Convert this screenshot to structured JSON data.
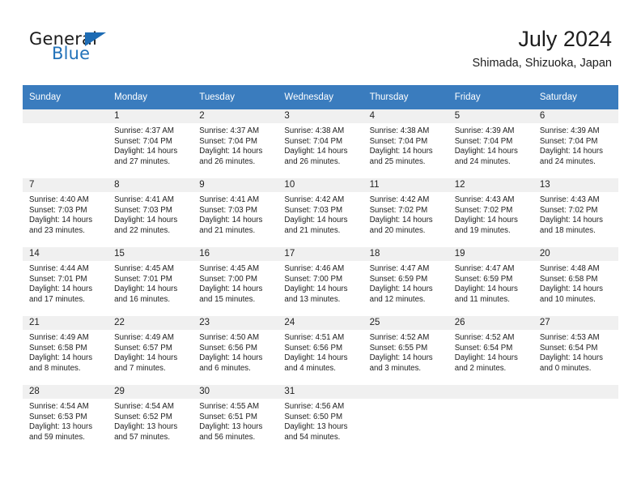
{
  "brand": {
    "name_part1": "General",
    "name_part2": "Blue",
    "logo_icon": "triangle-icon"
  },
  "header": {
    "title": "July 2024",
    "subtitle": "Shimada, Shizuoka, Japan"
  },
  "colors": {
    "header_blue": "#3a7cbe",
    "row_divider_blue": "#2f6fae",
    "daynum_band": "#f0f0f0",
    "brand_blue": "#2272b9"
  },
  "weekday_headers": [
    "Sunday",
    "Monday",
    "Tuesday",
    "Wednesday",
    "Thursday",
    "Friday",
    "Saturday"
  ],
  "weeks": [
    [
      {
        "day": "",
        "sunrise": "",
        "sunset": "",
        "daylight1": "",
        "daylight2": "",
        "empty": true
      },
      {
        "day": "1",
        "sunrise": "Sunrise: 4:37 AM",
        "sunset": "Sunset: 7:04 PM",
        "daylight1": "Daylight: 14 hours",
        "daylight2": "and 27 minutes.",
        "empty": false
      },
      {
        "day": "2",
        "sunrise": "Sunrise: 4:37 AM",
        "sunset": "Sunset: 7:04 PM",
        "daylight1": "Daylight: 14 hours",
        "daylight2": "and 26 minutes.",
        "empty": false
      },
      {
        "day": "3",
        "sunrise": "Sunrise: 4:38 AM",
        "sunset": "Sunset: 7:04 PM",
        "daylight1": "Daylight: 14 hours",
        "daylight2": "and 26 minutes.",
        "empty": false
      },
      {
        "day": "4",
        "sunrise": "Sunrise: 4:38 AM",
        "sunset": "Sunset: 7:04 PM",
        "daylight1": "Daylight: 14 hours",
        "daylight2": "and 25 minutes.",
        "empty": false
      },
      {
        "day": "5",
        "sunrise": "Sunrise: 4:39 AM",
        "sunset": "Sunset: 7:04 PM",
        "daylight1": "Daylight: 14 hours",
        "daylight2": "and 24 minutes.",
        "empty": false
      },
      {
        "day": "6",
        "sunrise": "Sunrise: 4:39 AM",
        "sunset": "Sunset: 7:04 PM",
        "daylight1": "Daylight: 14 hours",
        "daylight2": "and 24 minutes.",
        "empty": false
      }
    ],
    [
      {
        "day": "7",
        "sunrise": "Sunrise: 4:40 AM",
        "sunset": "Sunset: 7:03 PM",
        "daylight1": "Daylight: 14 hours",
        "daylight2": "and 23 minutes.",
        "empty": false
      },
      {
        "day": "8",
        "sunrise": "Sunrise: 4:41 AM",
        "sunset": "Sunset: 7:03 PM",
        "daylight1": "Daylight: 14 hours",
        "daylight2": "and 22 minutes.",
        "empty": false
      },
      {
        "day": "9",
        "sunrise": "Sunrise: 4:41 AM",
        "sunset": "Sunset: 7:03 PM",
        "daylight1": "Daylight: 14 hours",
        "daylight2": "and 21 minutes.",
        "empty": false
      },
      {
        "day": "10",
        "sunrise": "Sunrise: 4:42 AM",
        "sunset": "Sunset: 7:03 PM",
        "daylight1": "Daylight: 14 hours",
        "daylight2": "and 21 minutes.",
        "empty": false
      },
      {
        "day": "11",
        "sunrise": "Sunrise: 4:42 AM",
        "sunset": "Sunset: 7:02 PM",
        "daylight1": "Daylight: 14 hours",
        "daylight2": "and 20 minutes.",
        "empty": false
      },
      {
        "day": "12",
        "sunrise": "Sunrise: 4:43 AM",
        "sunset": "Sunset: 7:02 PM",
        "daylight1": "Daylight: 14 hours",
        "daylight2": "and 19 minutes.",
        "empty": false
      },
      {
        "day": "13",
        "sunrise": "Sunrise: 4:43 AM",
        "sunset": "Sunset: 7:02 PM",
        "daylight1": "Daylight: 14 hours",
        "daylight2": "and 18 minutes.",
        "empty": false
      }
    ],
    [
      {
        "day": "14",
        "sunrise": "Sunrise: 4:44 AM",
        "sunset": "Sunset: 7:01 PM",
        "daylight1": "Daylight: 14 hours",
        "daylight2": "and 17 minutes.",
        "empty": false
      },
      {
        "day": "15",
        "sunrise": "Sunrise: 4:45 AM",
        "sunset": "Sunset: 7:01 PM",
        "daylight1": "Daylight: 14 hours",
        "daylight2": "and 16 minutes.",
        "empty": false
      },
      {
        "day": "16",
        "sunrise": "Sunrise: 4:45 AM",
        "sunset": "Sunset: 7:00 PM",
        "daylight1": "Daylight: 14 hours",
        "daylight2": "and 15 minutes.",
        "empty": false
      },
      {
        "day": "17",
        "sunrise": "Sunrise: 4:46 AM",
        "sunset": "Sunset: 7:00 PM",
        "daylight1": "Daylight: 14 hours",
        "daylight2": "and 13 minutes.",
        "empty": false
      },
      {
        "day": "18",
        "sunrise": "Sunrise: 4:47 AM",
        "sunset": "Sunset: 6:59 PM",
        "daylight1": "Daylight: 14 hours",
        "daylight2": "and 12 minutes.",
        "empty": false
      },
      {
        "day": "19",
        "sunrise": "Sunrise: 4:47 AM",
        "sunset": "Sunset: 6:59 PM",
        "daylight1": "Daylight: 14 hours",
        "daylight2": "and 11 minutes.",
        "empty": false
      },
      {
        "day": "20",
        "sunrise": "Sunrise: 4:48 AM",
        "sunset": "Sunset: 6:58 PM",
        "daylight1": "Daylight: 14 hours",
        "daylight2": "and 10 minutes.",
        "empty": false
      }
    ],
    [
      {
        "day": "21",
        "sunrise": "Sunrise: 4:49 AM",
        "sunset": "Sunset: 6:58 PM",
        "daylight1": "Daylight: 14 hours",
        "daylight2": "and 8 minutes.",
        "empty": false
      },
      {
        "day": "22",
        "sunrise": "Sunrise: 4:49 AM",
        "sunset": "Sunset: 6:57 PM",
        "daylight1": "Daylight: 14 hours",
        "daylight2": "and 7 minutes.",
        "empty": false
      },
      {
        "day": "23",
        "sunrise": "Sunrise: 4:50 AM",
        "sunset": "Sunset: 6:56 PM",
        "daylight1": "Daylight: 14 hours",
        "daylight2": "and 6 minutes.",
        "empty": false
      },
      {
        "day": "24",
        "sunrise": "Sunrise: 4:51 AM",
        "sunset": "Sunset: 6:56 PM",
        "daylight1": "Daylight: 14 hours",
        "daylight2": "and 4 minutes.",
        "empty": false
      },
      {
        "day": "25",
        "sunrise": "Sunrise: 4:52 AM",
        "sunset": "Sunset: 6:55 PM",
        "daylight1": "Daylight: 14 hours",
        "daylight2": "and 3 minutes.",
        "empty": false
      },
      {
        "day": "26",
        "sunrise": "Sunrise: 4:52 AM",
        "sunset": "Sunset: 6:54 PM",
        "daylight1": "Daylight: 14 hours",
        "daylight2": "and 2 minutes.",
        "empty": false
      },
      {
        "day": "27",
        "sunrise": "Sunrise: 4:53 AM",
        "sunset": "Sunset: 6:54 PM",
        "daylight1": "Daylight: 14 hours",
        "daylight2": "and 0 minutes.",
        "empty": false
      }
    ],
    [
      {
        "day": "28",
        "sunrise": "Sunrise: 4:54 AM",
        "sunset": "Sunset: 6:53 PM",
        "daylight1": "Daylight: 13 hours",
        "daylight2": "and 59 minutes.",
        "empty": false
      },
      {
        "day": "29",
        "sunrise": "Sunrise: 4:54 AM",
        "sunset": "Sunset: 6:52 PM",
        "daylight1": "Daylight: 13 hours",
        "daylight2": "and 57 minutes.",
        "empty": false
      },
      {
        "day": "30",
        "sunrise": "Sunrise: 4:55 AM",
        "sunset": "Sunset: 6:51 PM",
        "daylight1": "Daylight: 13 hours",
        "daylight2": "and 56 minutes.",
        "empty": false
      },
      {
        "day": "31",
        "sunrise": "Sunrise: 4:56 AM",
        "sunset": "Sunset: 6:50 PM",
        "daylight1": "Daylight: 13 hours",
        "daylight2": "and 54 minutes.",
        "empty": false
      },
      {
        "day": "",
        "sunrise": "",
        "sunset": "",
        "daylight1": "",
        "daylight2": "",
        "empty": true
      },
      {
        "day": "",
        "sunrise": "",
        "sunset": "",
        "daylight1": "",
        "daylight2": "",
        "empty": true
      },
      {
        "day": "",
        "sunrise": "",
        "sunset": "",
        "daylight1": "",
        "daylight2": "",
        "empty": true
      }
    ]
  ]
}
